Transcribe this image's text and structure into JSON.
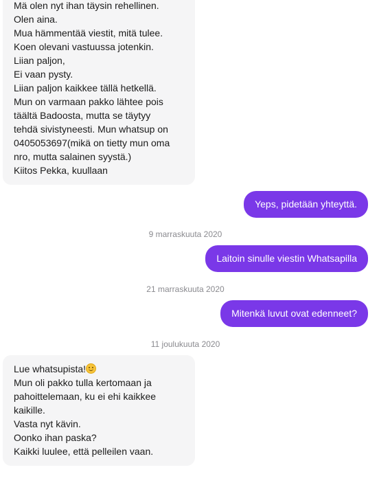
{
  "messages": {
    "first_incoming": [
      "Mä olen nyt ihan täysin rehellinen.",
      "Olen aina.",
      "Mua hämmentää viestit, mitä tulee.",
      "Koen olevani vastuussa jotenkin.",
      "Liian paljon,",
      "Ei vaan pysty.",
      "Liian paljon kaikkee tällä hetkellä.",
      "Mun on varmaan pakko lähtee pois",
      "täältä Badoosta, mutta se täytyy",
      "tehdä sivistyneesti. Mun whatsup on",
      "0405053697(mikä on tietty mun oma",
      "nro, mutta salainen syystä.)",
      "Kiitos Pekka, kuullaan"
    ],
    "outgoing_1": "Yeps, pidetään yhteyttä.",
    "date_1": "9 marraskuuta 2020",
    "outgoing_2": "Laitoin sinulle viestin Whatsapilla",
    "date_2": "21 marraskuuta 2020",
    "outgoing_3": "Mitenkä luvut ovat edenneet?",
    "date_3": "11 joulukuuta 2020",
    "second_incoming": [
      "Lue whatsupista!",
      "Mun oli pakko tulla kertomaan ja",
      "pahoittelemaan, ku ei ehi kaikkee",
      "kaikille.",
      "Vasta nyt kävin.",
      "Oonko ihan paska?",
      "Kaikki luulee, että pelleilen vaan."
    ],
    "smiley_icon": "smiling-face-emoji"
  },
  "colors": {
    "outgoing_bubble": "#7a38e8",
    "incoming_bubble": "#f5f5f6",
    "date_text": "#8a8a8f"
  }
}
